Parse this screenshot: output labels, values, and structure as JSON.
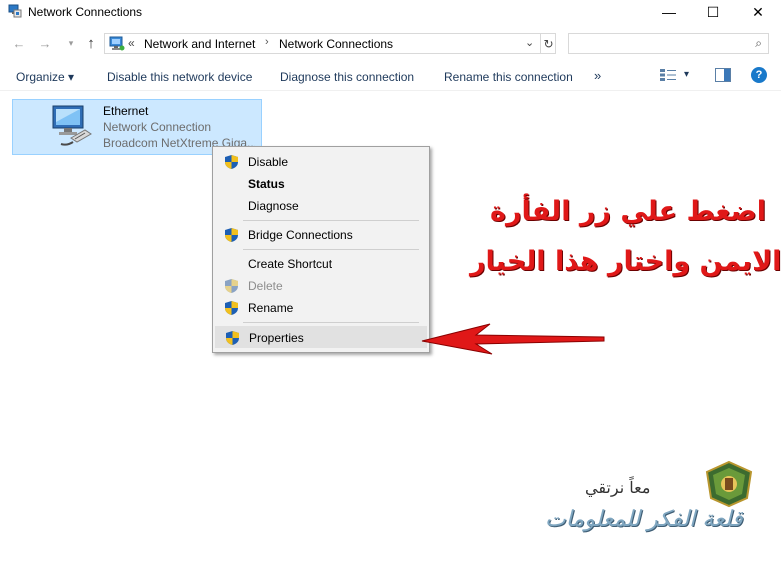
{
  "window": {
    "title": "Network Connections",
    "controls": {
      "minimize": "—",
      "maximize": "☐",
      "close": "✕"
    }
  },
  "nav": {
    "back": "←",
    "forward": "→",
    "recent": "▾",
    "up": "↑",
    "overflow": "«",
    "breadcrumbs": [
      "Network and Internet",
      "Network Connections"
    ],
    "separator": "›",
    "dropdown": "⌄",
    "refresh": "↻",
    "search_placeholder": "",
    "search_icon": "⌕"
  },
  "commands": {
    "organize": "Organize ▾",
    "disable": "Disable this network device",
    "diagnose": "Diagnose this connection",
    "rename": "Rename this connection",
    "more": "»",
    "view_dropdown": "▾",
    "help": "?"
  },
  "connection": {
    "name": "Ethernet",
    "status": "Network Connection",
    "device": "Broadcom NetXtreme Giga..."
  },
  "context_menu": {
    "items": [
      {
        "label": "Disable",
        "shield": true
      },
      {
        "label": "Status",
        "bold": true
      },
      {
        "label": "Diagnose"
      },
      {
        "label": "Bridge Connections",
        "shield": true
      },
      {
        "label": "Create Shortcut"
      },
      {
        "label": "Delete",
        "shield": true,
        "disabled": true
      },
      {
        "label": "Rename",
        "shield": true
      },
      {
        "label": "Properties",
        "shield": true,
        "highlighted": true
      }
    ]
  },
  "annotation": {
    "line1": "اضغط علي زر الفأرة",
    "line2": "الايمن واختار هذا الخيار",
    "color": "#e01818"
  },
  "watermark": {
    "line1": "معاً نرتقي",
    "line2": "قلعة الفكر للمعلومات"
  },
  "colors": {
    "selection_bg": "#cce8ff",
    "selection_border": "#99d1ff",
    "command_text": "#1e395b",
    "menu_bg": "#f2f2f2"
  }
}
